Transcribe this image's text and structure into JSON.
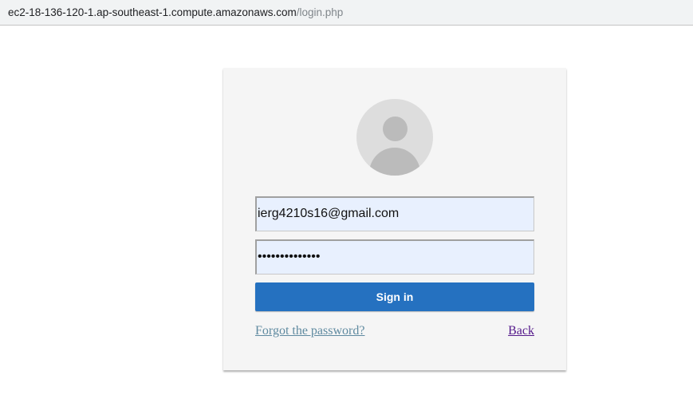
{
  "browser": {
    "url_host": "ec2-18-136-120-1.ap-southeast-1.compute.amazonaws.com",
    "url_path": "/login.php"
  },
  "login": {
    "avatar_icon": "user-avatar-icon",
    "email_value": "ierg4210s16@gmail.com",
    "password_value": "••••••••••••••",
    "sign_in_label": "Sign in",
    "forgot_label": "Forgot the password?",
    "back_label": "Back"
  },
  "colors": {
    "card_background": "#f5f5f5",
    "input_background": "#e8f0fe",
    "button_background": "#2571c0",
    "forgot_link": "#5f8aa0",
    "back_link_visited": "#551a8b"
  }
}
